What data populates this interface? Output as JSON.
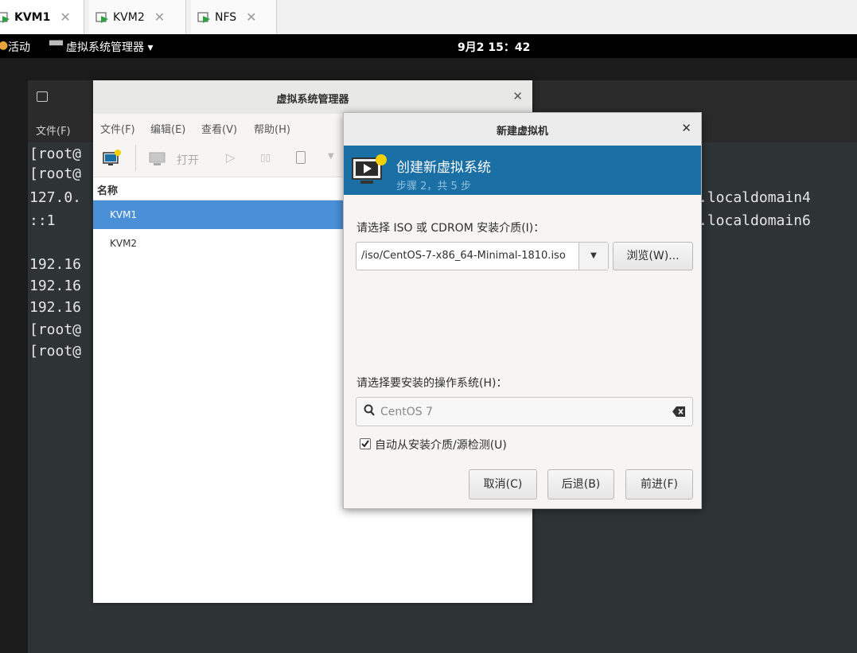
{
  "host_tabs": [
    {
      "label": "KVM1",
      "active": true
    },
    {
      "label": "KVM2",
      "active": false
    },
    {
      "label": "NFS",
      "active": false
    }
  ],
  "gnome": {
    "activities": "活动",
    "app_menu": "虚拟系统管理器 ▾",
    "clock": "9月2 15：42"
  },
  "terminal": {
    "menu_file": "文件(F)",
    "lines": [
      "[root@",
      "[root@",
      "127.0.",
      "::1",
      "",
      "192.16",
      "192.16",
      "192.16",
      "[root@",
      "[root@"
    ],
    "right_lines": [
      ".localdomain4",
      ".localdomain6"
    ]
  },
  "virt_manager": {
    "title": "虚拟系统管理器",
    "menu": [
      "文件(F)",
      "编辑(E)",
      "查看(V)",
      "帮助(H)"
    ],
    "open_label": "打开",
    "column_name": "名称",
    "vms": [
      "KVM1",
      "KVM2"
    ]
  },
  "dialog": {
    "title": "新建虚拟机",
    "banner_title": "创建新虚拟系统",
    "banner_step": "步骤 2，共 5 步",
    "iso_label": "请选择 ISO 或 CDROM 安装介质(I)：",
    "iso_value": "/iso/CentOS-7-x86_64-Minimal-1810.iso",
    "browse": "浏览(W)...",
    "os_label": "请选择要安装的操作系统(H)：",
    "os_search_value": "CentOS 7",
    "autodetect_label": "自动从安装介质/源检测(U)",
    "autodetect_checked": true,
    "cancel": "取消(C)",
    "back": "后退(B)",
    "forward": "前进(F)"
  },
  "colors": {
    "banner": "#1a6fa5",
    "selected_row": "#4a90d9",
    "terminal_bg": "#2e3436"
  }
}
